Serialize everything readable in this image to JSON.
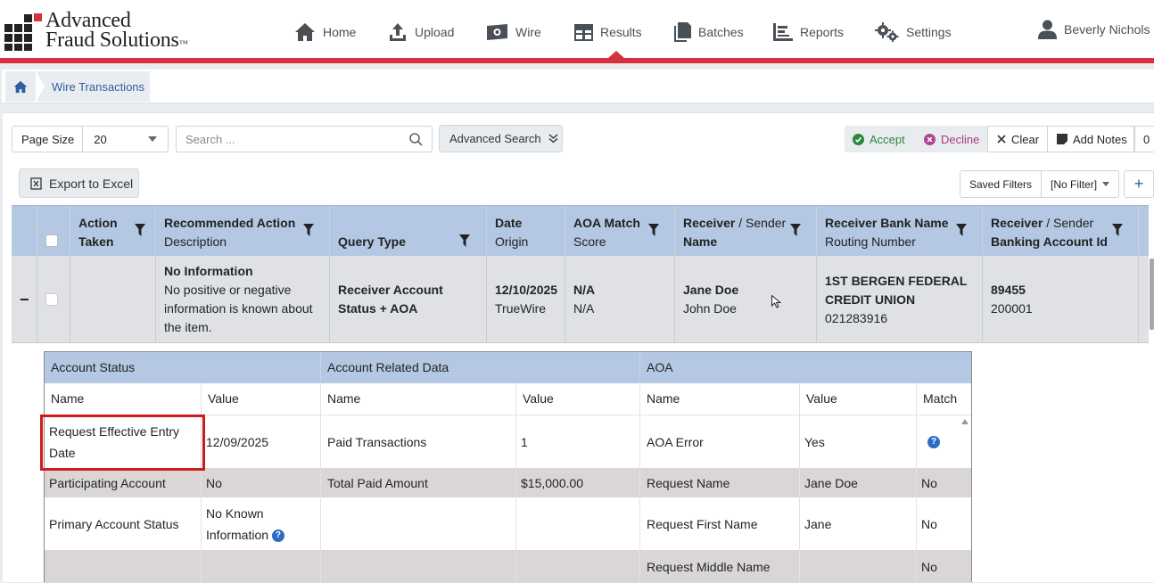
{
  "brand": {
    "line1": "Advanced",
    "line2": "Fraud Solutions",
    "tm": "™",
    "accent": "#d6323d"
  },
  "nav": [
    {
      "icon": "home-icon",
      "label": "Home"
    },
    {
      "icon": "upload-icon",
      "label": "Upload"
    },
    {
      "icon": "money-icon",
      "label": "Wire"
    },
    {
      "icon": "results-icon",
      "label": "Results"
    },
    {
      "icon": "batches-icon",
      "label": "Batches"
    },
    {
      "icon": "reports-icon",
      "label": "Reports"
    },
    {
      "icon": "settings-icon",
      "label": "Settings"
    }
  ],
  "user": {
    "name": "Beverly Nichols"
  },
  "breadcrumb": {
    "current": "Wire Transactions"
  },
  "toolbar": {
    "page_size_label": "Page Size",
    "page_size_value": "20",
    "search_placeholder": "Search ...",
    "advanced_search": "Advanced Search",
    "accept": "Accept",
    "decline": "Decline",
    "clear": "Clear",
    "add_notes": "Add Notes",
    "count": "0",
    "export": "Export to Excel",
    "saved_filters": "Saved Filters",
    "filter_value": "[No Filter]",
    "add": "+"
  },
  "columns": [
    {
      "l1": "Action",
      "l2": "Taken",
      "l1bold": true,
      "l2bold": true
    },
    {
      "l1": "Recommended Action",
      "l2": "Description",
      "l1bold": true,
      "l2bold": false
    },
    {
      "l1": "",
      "l2": "Query Type",
      "l1bold": false,
      "l2bold": true
    },
    {
      "l1": "Date",
      "l2": "Origin",
      "l1bold": true,
      "l2bold": false
    },
    {
      "l1": "AOA Match",
      "l2": "Score",
      "l1bold": true,
      "l2bold": false
    },
    {
      "l1a": "Receiver",
      "l1b": " / Sender",
      "l2": "Name",
      "l2bold": true
    },
    {
      "l1": "Receiver Bank Name",
      "l2": "Routing Number",
      "l1bold": true,
      "l2bold": false
    },
    {
      "l1a": "Receiver",
      "l1b": " / Sender",
      "l2": "Banking Account Id",
      "l2bold": true
    }
  ],
  "row": {
    "expand": "−",
    "rec_title": "No Information",
    "rec_desc": "No positive or negative information is known about the item.",
    "query_type": "Receiver Account Status + AOA",
    "date": "12/10/2025",
    "origin": "TrueWire",
    "aoa_match": "N/A",
    "aoa_score": "N/A",
    "receiver_name": "Jane Doe",
    "sender_name": "John Doe",
    "bank_name": "1ST BERGEN FEDERAL CREDIT UNION",
    "routing": "021283916",
    "receiver_acct": "89455",
    "sender_acct": "200001"
  },
  "detail": {
    "groups": [
      "Account Status",
      "Account Related Data",
      "AOA"
    ],
    "subheads": [
      "Name",
      "Value",
      "Name",
      "Value",
      "Name",
      "Value",
      "Match"
    ],
    "rows": [
      [
        "Request Effective Entry Date",
        "12/09/2025",
        "Paid Transactions",
        "1",
        "AOA Error",
        "Yes",
        ""
      ],
      [
        "Participating Account",
        "No",
        "Total Paid Amount",
        "$15,000.00",
        "Request Name",
        "Jane Doe",
        "No"
      ],
      [
        "Primary Account Status",
        "No Known Information",
        "",
        "",
        "Request First Name",
        "Jane",
        "No"
      ],
      [
        "",
        "",
        "",
        "",
        "Request Middle Name",
        "",
        "No"
      ]
    ],
    "info_mark": "?"
  }
}
